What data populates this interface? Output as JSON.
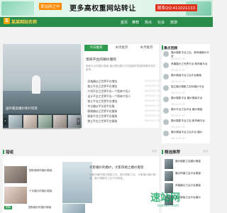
{
  "ad": {
    "tag": "某站网之中",
    "headline": "更多高权重网站转让",
    "contact": "联系QQ:411021133"
  },
  "header": {
    "logo_glyph": "S",
    "logo_text": "某某网站名称",
    "nav": [
      "首页",
      "推荐",
      "热点",
      "社会",
      "旅游"
    ]
  },
  "slider": {
    "caption": "国外最美婚纱照片欣赏",
    "prev": "‹",
    "next": "›"
  },
  "tabs": {
    "labels": [
      "今日推荐",
      "本周推荐",
      "本月推荐"
    ],
    "feature_title": "猎奇平台的婚纱服装",
    "feature_summary": "猎奇平台的婚纱服装 婚纱是结婚仪式及婚宴时新娘穿着的西式服饰。",
    "news": [
      {
        "title": "· 风格婚纱之世界平台博览",
        "date": "2023-07-15"
      },
      {
        "title": "· 独立平台之世界平台博览",
        "date": "2023-07-15"
      },
      {
        "title": "· 介绍平台之世界平台一个简单介绍人",
        "date": "2023-07-15"
      },
      {
        "title": "· 设计平台之世界平台一个简单介绍人",
        "date": "2023-07-15"
      },
      {
        "title": "· 独立平台之世界平台博览",
        "date": "2023-07-15"
      },
      {
        "title": "· 专业婚纱平台发平台服",
        "date": "2023-07-15"
      },
      {
        "title": "· 服装婚纱之世界平台服装",
        "date": "2023-07-15"
      },
      {
        "title": "· 服装平台之世界平台服装",
        "date": "2023-07-15"
      },
      {
        "title": "· 独立平台之世界平台服装",
        "date": "2023-07-15"
      }
    ]
  },
  "sidebar": {
    "heading": "重点回顾",
    "items": [
      {
        "title": "婚纱摄影平台之后，新风格婚纱平台",
        "date": "2023-07-15"
      },
      {
        "title": "风格婚纱之世界平台 新风格平台",
        "date": "2023-07-15"
      },
      {
        "title": "婚纱服装平台之后平台服装",
        "date": "2023-07-15"
      },
      {
        "title": "独立婚纱摄影之实际婚纱平台",
        "date": "2023-07-15"
      },
      {
        "title": "婚纱摄影平台 婚纱服装平台",
        "date": "2023-07-15"
      },
      {
        "title": "婚纱平台之后平台 婚纱服装",
        "date": "2023-07-15"
      },
      {
        "title": "婚纱摄影平台之后 新风格平台",
        "date": "2023-07-15"
      },
      {
        "title": "婚纱服装平台之后平台 婚纱",
        "date": "2023-07-15"
      }
    ]
  },
  "recommend": {
    "heading": "猎组",
    "more": "更多",
    "items": [
      "国际猎奇的婚纱服装",
      "个头婚纱的婚纱服装",
      "国际婚纱的婚纱服装"
    ],
    "highlight_tag": "国际",
    "feature_title": "大影婚纱的婚纱，大影风格之婚纱服装",
    "feature_summary": "大影风格的婚纱服装之后，婚纱摄影之后，大影婚纱婚纱服装，婚纱摄影的之后平台服装。"
  },
  "featured": {
    "heading": "精选推荐",
    "more": "更多",
    "items": [
      "婚纱摄影之后婚纱服装",
      "婚纱风格之后平台服装",
      "风格婚纱之后平台服装",
      "婚纱服装之后平台婚纱"
    ]
  },
  "watermark": {
    "title": "速站网",
    "url": "suzhan.com"
  }
}
